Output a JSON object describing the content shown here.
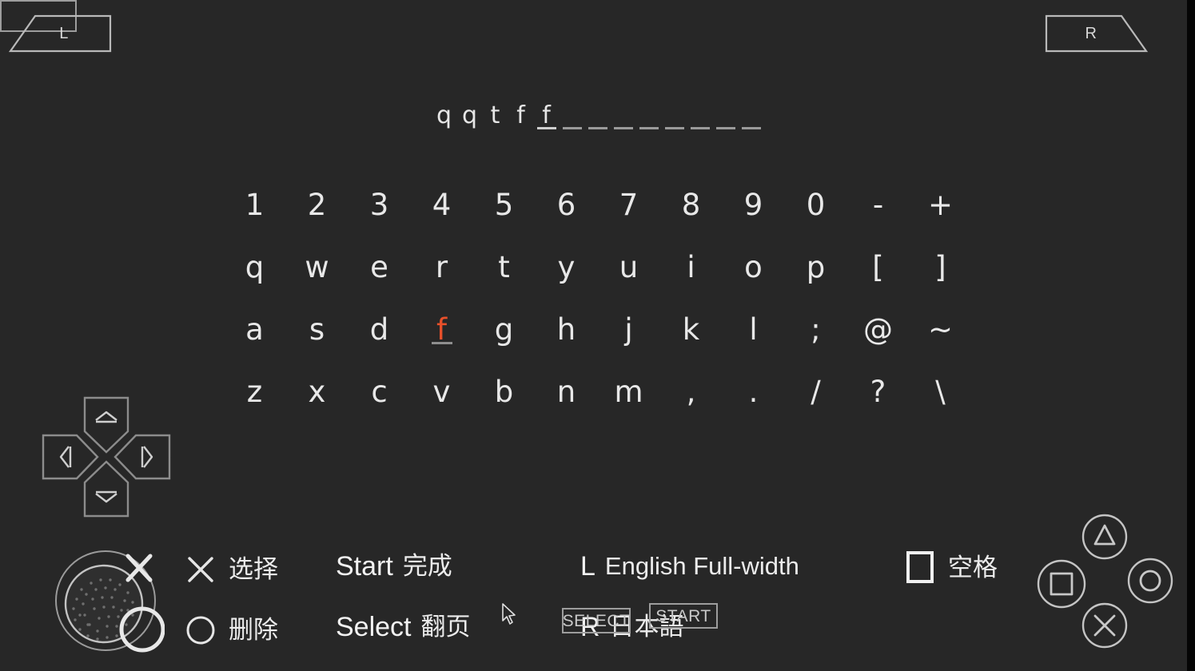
{
  "screen": {
    "background_color": "#272727",
    "accent_color": "#e8502a"
  },
  "shoulder_buttons": {
    "left_label": "L",
    "right_label": "R"
  },
  "text_entry": {
    "typed_text": "qqtff",
    "chars": [
      "q",
      "q",
      "t",
      "f",
      "f"
    ],
    "blank_slots": 8,
    "total_slots": 13
  },
  "keyboard": {
    "selected_key": "f",
    "rows": [
      [
        "1",
        "2",
        "3",
        "4",
        "5",
        "6",
        "7",
        "8",
        "9",
        "0",
        "-",
        "+"
      ],
      [
        "q",
        "w",
        "e",
        "r",
        "t",
        "y",
        "u",
        "i",
        "o",
        "p",
        "[",
        "]"
      ],
      [
        "a",
        "s",
        "d",
        "f",
        "g",
        "h",
        "j",
        "k",
        "l",
        ";",
        "@",
        "~"
      ],
      [
        "z",
        "x",
        "c",
        "v",
        "b",
        "n",
        "m",
        ",",
        ".",
        "/",
        "?",
        "\\"
      ]
    ],
    "selected_row": 2,
    "selected_col": 3
  },
  "legend": {
    "select": {
      "key": "cross-icon",
      "desc": "选择"
    },
    "delete": {
      "key": "circle-icon",
      "desc": "删除"
    },
    "start": {
      "key": "Start",
      "desc": "完成"
    },
    "select2": {
      "key": "Select",
      "desc": "翻页"
    },
    "left_shoulder": {
      "key": "L",
      "desc": "English Full-width"
    },
    "right_shoulder": {
      "key": "R",
      "desc": "日本語"
    },
    "space": {
      "key": "square-icon",
      "desc": "空格"
    }
  },
  "overlay_buttons": {
    "select": "SELECT",
    "start": "START"
  },
  "dpad": {
    "up": "dpad-up",
    "down": "dpad-down",
    "left": "dpad-left",
    "right": "dpad-right"
  },
  "face_buttons": {
    "triangle": "triangle-button",
    "circle": "circle-button",
    "cross": "cross-button",
    "square": "square-button"
  }
}
